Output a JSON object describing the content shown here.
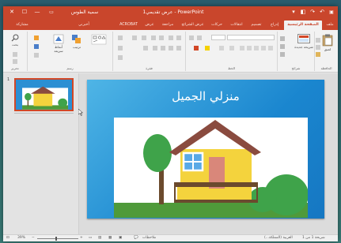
{
  "window": {
    "doc_title": "عرض تقديمي1 - PowerPoint",
    "user_name": "سمية الطوس",
    "controls": {
      "minimize": "—",
      "restore": "☐",
      "close": "✕"
    }
  },
  "quick_access": {
    "save": "💾",
    "undo": "↶",
    "redo": "↷",
    "customize": "▾"
  },
  "ribbon_tabs": [
    {
      "label": "ملف"
    },
    {
      "label": "الصفحة الرئيسية",
      "active": true
    },
    {
      "label": "إدراج"
    },
    {
      "label": "تصميم"
    },
    {
      "label": "انتقالات"
    },
    {
      "label": "حركات"
    },
    {
      "label": "عرض الشرائح"
    },
    {
      "label": "مراجعة"
    },
    {
      "label": "عرض"
    },
    {
      "label": "ACROBAT"
    },
    {
      "label": "أخبرني"
    },
    {
      "label": "مشاركة"
    }
  ],
  "ribbon_groups": {
    "clipboard": {
      "label": "الحافظة",
      "paste": "لصق"
    },
    "slides": {
      "label": "شرائح",
      "new_slide": "شريحة جديدة"
    },
    "font": {
      "label": "الخط"
    },
    "paragraph": {
      "label": "فقرة"
    },
    "drawing": {
      "label": "رسم",
      "shapes": "أشكال",
      "arrange": "ترتيب",
      "quick_styles": "أنماط سريعة"
    },
    "editing": {
      "label": "تحرير",
      "find": "بحث"
    }
  },
  "slides_pane": {
    "slide_number": "1"
  },
  "slide": {
    "title": "منزلي الجميل"
  },
  "statusbar": {
    "slide_info": "شريحة 1 من 1",
    "language": "العربية (المملكة...)",
    "notes": "ملاحظات",
    "zoom": "39%"
  },
  "colors": {
    "accent": "#c9462c",
    "slide_bg": "#1a86cf",
    "house_wall": "#f4d33d",
    "roof": "#8a4b3f",
    "grass": "#4f9a3a",
    "tree": "#3fa34a"
  },
  "icons": {
    "cursor": "mouse-pointer-icon"
  }
}
